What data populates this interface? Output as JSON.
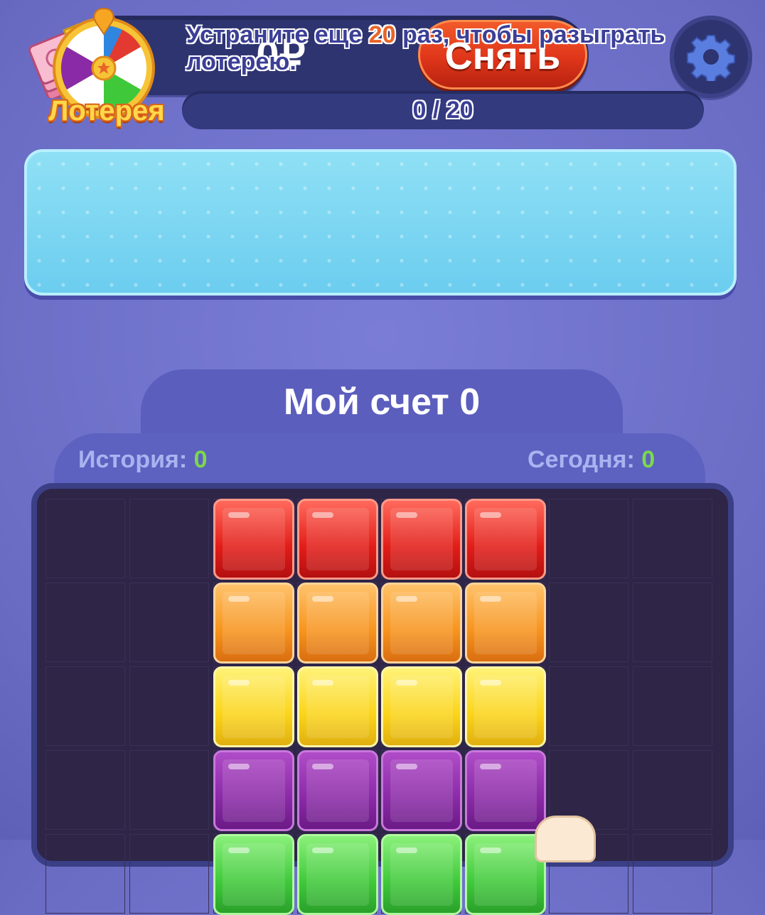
{
  "header": {
    "balance": "0₽",
    "withdraw_label": "Снять"
  },
  "lottery": {
    "label": "Лотерея",
    "message_prefix": "Устраните еще",
    "message_count": "20",
    "message_suffix": "раз, чтобы разыграть лотерею.",
    "progress_text": "0 / 20",
    "progress_fraction": 0
  },
  "score": {
    "title": "Мой счет 0",
    "history_label": "История:",
    "history_value": "0",
    "today_label": "Сегодня:",
    "today_value": "0"
  },
  "board": {
    "grid_columns": 8,
    "visible_rows": [
      [
        "empty",
        "empty",
        "red",
        "red",
        "red",
        "red",
        "empty",
        "empty"
      ],
      [
        "empty",
        "empty",
        "orange",
        "orange",
        "orange",
        "orange",
        "empty",
        "empty"
      ],
      [
        "empty",
        "empty",
        "yellow",
        "yellow",
        "yellow",
        "yellow",
        "empty",
        "empty"
      ],
      [
        "empty",
        "empty",
        "purple",
        "purple",
        "purple",
        "purple",
        "empty",
        "empty"
      ],
      [
        "empty",
        "empty",
        "green",
        "green",
        "green",
        "green",
        "empty",
        "empty"
      ]
    ]
  },
  "colors": {
    "background": "#6f72cc",
    "withdraw_button": "#e0361a",
    "lottery_banner": "#6ccdef",
    "accent_green": "#7bd84e"
  },
  "icons": [
    "money-stack-icon",
    "gear-icon",
    "lottery-wheel-icon",
    "pointer-hand-icon"
  ]
}
